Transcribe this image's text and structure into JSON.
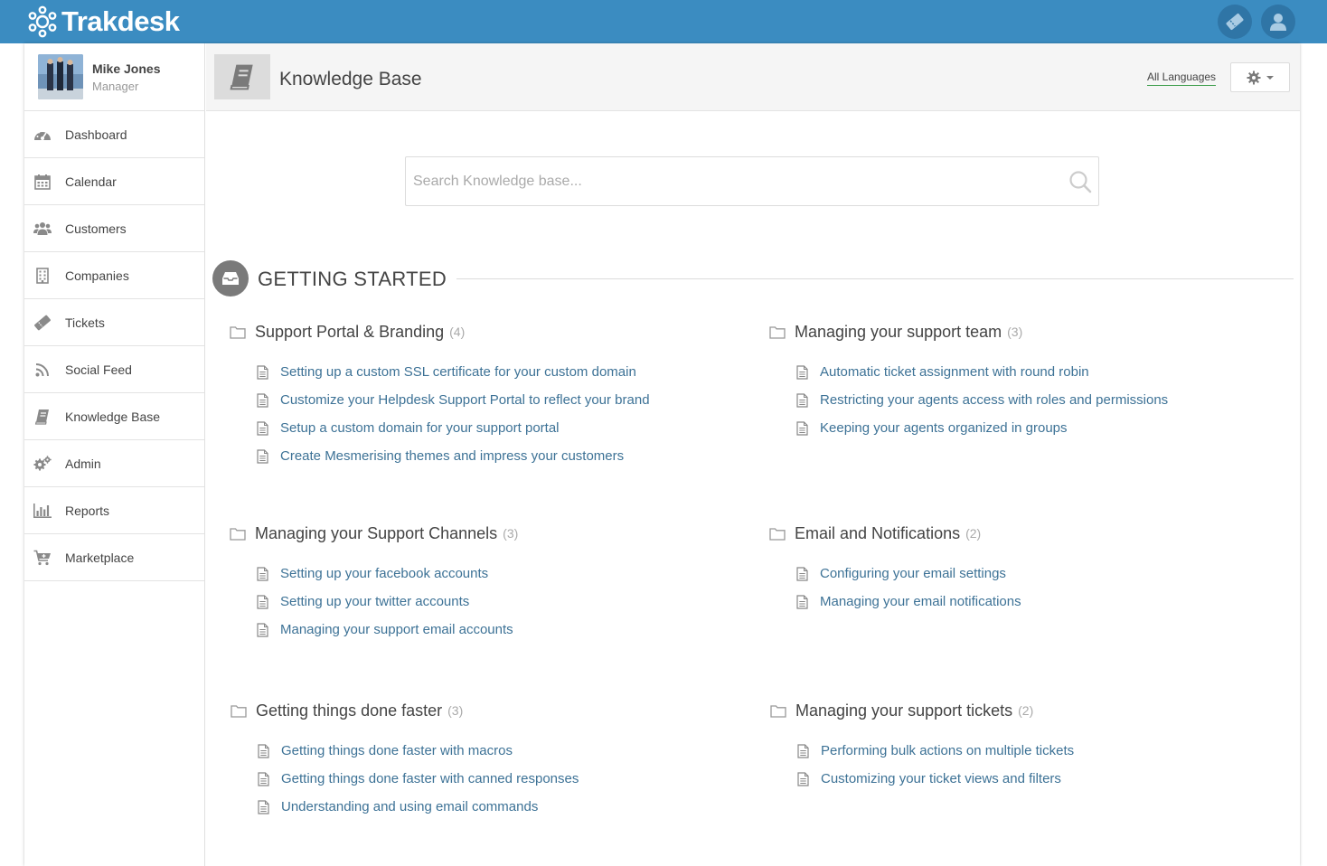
{
  "brand": {
    "name": "Trakdesk",
    "topbar_color": "#3b8cc1"
  },
  "user": {
    "name": "Mike Jones",
    "role": "Manager"
  },
  "sidebar": {
    "items": [
      {
        "label": "Dashboard",
        "icon": "dashboard-icon"
      },
      {
        "label": "Calendar",
        "icon": "calendar-icon"
      },
      {
        "label": "Customers",
        "icon": "users-icon"
      },
      {
        "label": "Companies",
        "icon": "building-icon"
      },
      {
        "label": "Tickets",
        "icon": "ticket-icon"
      },
      {
        "label": "Social Feed",
        "icon": "rss-icon"
      },
      {
        "label": "Knowledge Base",
        "icon": "book-icon"
      },
      {
        "label": "Admin",
        "icon": "cogs-icon"
      },
      {
        "label": "Reports",
        "icon": "bar-chart-icon"
      },
      {
        "label": "Marketplace",
        "icon": "cart-icon"
      }
    ]
  },
  "header": {
    "title": "Knowledge Base",
    "language_link": "All Languages"
  },
  "search": {
    "placeholder": "Search Knowledge base..."
  },
  "section": {
    "title": "GETTING STARTED"
  },
  "categories": [
    {
      "title": "Support Portal & Branding",
      "count": "(4)",
      "articles": [
        "Setting up a custom SSL certificate for your custom domain",
        "Customize your Helpdesk Support Portal to reflect your brand",
        "Setup a custom domain for your support portal",
        "Create Mesmerising themes and impress your customers"
      ]
    },
    {
      "title": "Managing your support team",
      "count": "(3)",
      "articles": [
        "Automatic ticket assignment with round robin",
        "Restricting your agents access with roles and permissions",
        "Keeping your agents organized in groups"
      ]
    },
    {
      "title": "Managing your Support Channels",
      "count": "(3)",
      "articles": [
        "Setting up your facebook accounts",
        "Setting up your twitter accounts",
        "Managing your support email accounts"
      ]
    },
    {
      "title": "Email and Notifications",
      "count": "(2)",
      "articles": [
        "Configuring your email settings",
        "Managing your email notifications"
      ]
    },
    {
      "title": "Getting things done faster",
      "count": "(3)",
      "articles": [
        "Getting things done faster with macros",
        "Getting things done faster with canned responses",
        "Understanding and using email commands"
      ]
    },
    {
      "title": "Managing your support tickets",
      "count": "(2)",
      "articles": [
        "Performing bulk actions on multiple tickets",
        "Customizing your ticket views and filters"
      ]
    }
  ]
}
